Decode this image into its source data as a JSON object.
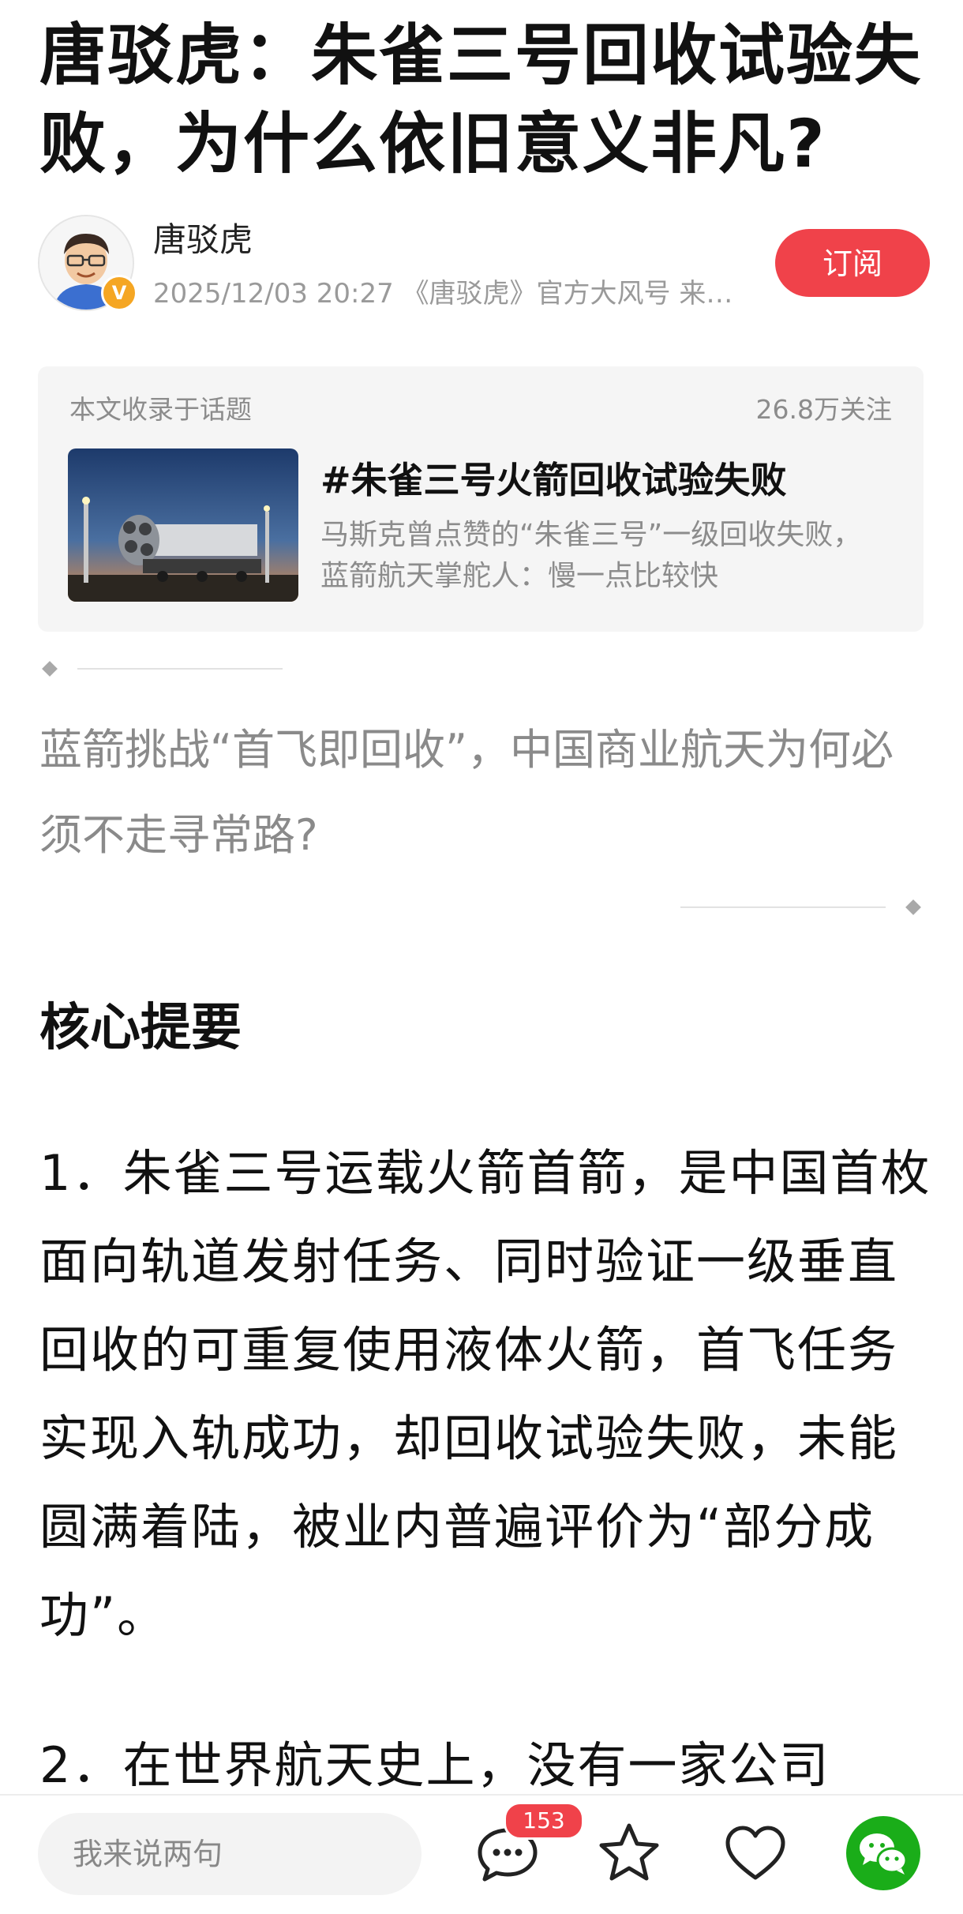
{
  "article": {
    "title": "唐驳虎：朱雀三号回收试验失败，为什么依旧意义非凡?",
    "author": "唐驳虎",
    "meta": "2025/12/03 20:27 《唐驳虎》官方大风号 来…",
    "subscribe_label": "订阅",
    "verified_badge": "V"
  },
  "topic": {
    "label": "本文收录于话题",
    "followers": "26.8万关注",
    "title": "#朱雀三号火箭回收试验失败",
    "description": "马斯克曾点赞的“朱雀三号”一级回收失败，蓝箭航天掌舵人：慢一点比较快"
  },
  "quote": "蓝箭挑战“首飞即回收”，中国商业航天为何必须不走寻常路?",
  "section_heading": "核心提要",
  "paragraphs": [
    "1．朱雀三号运载火箭首箭，是中国首枚面向轨道发射任务、同时验证一级垂直回收的可重复使用液体火箭，首飞任务实现入轨成功，却回收试验失败，未能圆满着陆，被业内普遍评价为“部分成功”。",
    "2．在世界航天史上，没有一家公司"
  ],
  "bottom_bar": {
    "comment_placeholder": "我来说两句",
    "comment_count": "153",
    "icons": [
      "comment-icon",
      "star-icon",
      "heart-icon",
      "wechat-icon"
    ]
  },
  "colors": {
    "accent_red": "#f0424a",
    "wechat_green": "#1aad19",
    "verified_orange": "#f5a623"
  }
}
